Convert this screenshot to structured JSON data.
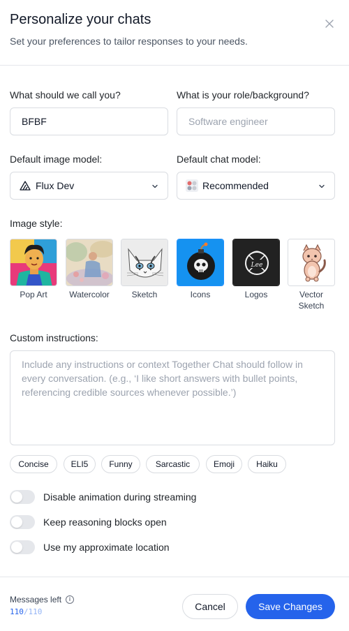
{
  "dialog": {
    "title": "Personalize your chats",
    "subtitle": "Set your preferences to tailor responses to your needs.",
    "close_icon": "close-icon"
  },
  "form": {
    "name_label": "What should we call you?",
    "name_value": "BFBF",
    "role_label": "What is your role/background?",
    "role_placeholder": "Software engineer",
    "image_model_label": "Default image model:",
    "image_model_value": "Flux Dev",
    "chat_model_label": "Default chat model:",
    "chat_model_value": "Recommended",
    "image_style_label": "Image style:",
    "image_styles": [
      {
        "label": "Pop Art",
        "icon": "pop-art-thumbnail"
      },
      {
        "label": "Watercolor",
        "icon": "watercolor-thumbnail"
      },
      {
        "label": "Sketch",
        "icon": "sketch-thumbnail"
      },
      {
        "label": "Icons",
        "icon": "icons-thumbnail"
      },
      {
        "label": "Logos",
        "icon": "logos-thumbnail"
      },
      {
        "label": "Vector Sketch",
        "icon": "vector-sketch-thumbnail"
      }
    ],
    "custom_instructions_label": "Custom instructions:",
    "custom_instructions_placeholder": "Include any instructions or context Together Chat should follow in every conversation. (e.g., ‘I like short answers with bullet points, referencing credible sources whenever possible.’)",
    "chips": [
      "Concise",
      "ELI5",
      "Funny",
      "Sarcastic",
      "Emoji",
      "Haiku"
    ],
    "toggles": [
      {
        "label": "Disable animation during streaming",
        "on": false
      },
      {
        "label": "Keep reasoning blocks open",
        "on": false
      },
      {
        "label": "Use my approximate location",
        "on": false
      }
    ]
  },
  "footer": {
    "messages_label": "Messages left",
    "messages_used": "110",
    "messages_sep": "/",
    "messages_total": "110",
    "cancel_label": "Cancel",
    "save_label": "Save Changes"
  },
  "colors": {
    "accent": "#2563eb",
    "border": "#d9dce1"
  }
}
